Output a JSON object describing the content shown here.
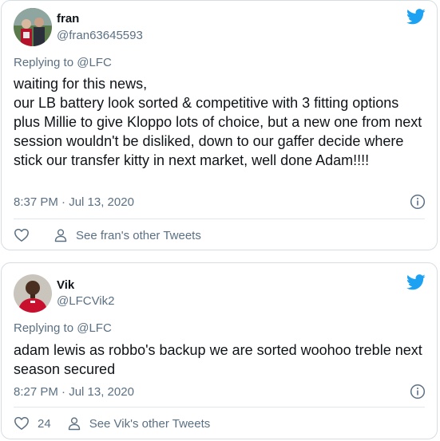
{
  "colors": {
    "twitter_blue": "#1da1f2",
    "text_primary": "#0f1419",
    "text_secondary": "#5b7083",
    "card_border": "#d6dde2"
  },
  "tweets": [
    {
      "name": "fran",
      "handle": "@fran63645593",
      "replying_to": "Replying to @LFC",
      "text": "waiting for this news,\nour LB battery look sorted & competitive with 3 fitting options plus Millie to give Kloppo lots of choice, but a new one from next session wouldn't be disliked, down to our gaffer decide where stick our transfer kitty in next market, well done Adam!!!!",
      "timestamp": "8:37 PM · Jul 13, 2020",
      "likes": "",
      "other_tweets_label": "See fran's other Tweets",
      "icons": [
        "twitter-bird-icon",
        "info-icon",
        "heart-icon",
        "person-icon"
      ]
    },
    {
      "name": "Vik",
      "handle": "@LFCVik2",
      "replying_to": "Replying to @LFC",
      "text": "adam lewis as robbo's backup we are sorted woohoo treble next season secured",
      "timestamp": "8:27 PM · Jul 13, 2020",
      "likes": "24",
      "other_tweets_label": "See Vik's other Tweets",
      "icons": [
        "twitter-bird-icon",
        "info-icon",
        "heart-icon",
        "person-icon"
      ]
    }
  ]
}
